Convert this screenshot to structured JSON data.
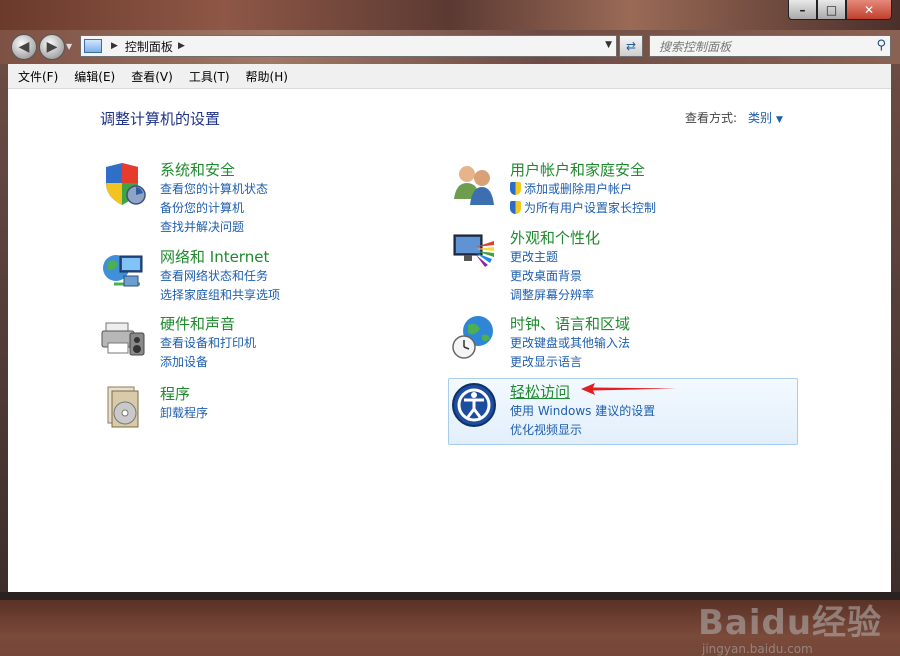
{
  "window": {
    "minimize_icon": "minimize-icon",
    "maximize_icon": "maximize-icon",
    "close_icon": "close-icon"
  },
  "address": {
    "breadcrumb": "控制面板",
    "search_placeholder": "搜索控制面板"
  },
  "menu": [
    "文件(F)",
    "编辑(E)",
    "查看(V)",
    "工具(T)",
    "帮助(H)"
  ],
  "main": {
    "heading": "调整计算机的设置",
    "view_by_label": "查看方式:",
    "view_by_value": "类别"
  },
  "categories": {
    "system": {
      "title": "系统和安全",
      "links": [
        "查看您的计算机状态",
        "备份您的计算机",
        "查找并解决问题"
      ]
    },
    "network": {
      "title": "网络和 Internet",
      "links": [
        "查看网络状态和任务",
        "选择家庭组和共享选项"
      ]
    },
    "hardware": {
      "title": "硬件和声音",
      "links": [
        "查看设备和打印机",
        "添加设备"
      ]
    },
    "programs": {
      "title": "程序",
      "links": [
        "卸载程序"
      ]
    },
    "users": {
      "title": "用户帐户和家庭安全",
      "links": [
        "添加或删除用户帐户",
        "为所有用户设置家长控制"
      ]
    },
    "appearance": {
      "title": "外观和个性化",
      "links": [
        "更改主题",
        "更改桌面背景",
        "调整屏幕分辨率"
      ]
    },
    "clock": {
      "title": "时钟、语言和区域",
      "links": [
        "更改键盘或其他输入法",
        "更改显示语言"
      ]
    },
    "ease": {
      "title": "轻松访问",
      "links": [
        "使用 Windows 建议的设置",
        "优化视频显示"
      ]
    }
  },
  "colors": {
    "category_title": "#1f8a2e",
    "link": "#1e5eb0",
    "heading": "#1e3287",
    "annotation_arrow": "#e02020"
  },
  "watermark": {
    "main": "Baidu经验",
    "sub": "jingyan.baidu.com"
  }
}
